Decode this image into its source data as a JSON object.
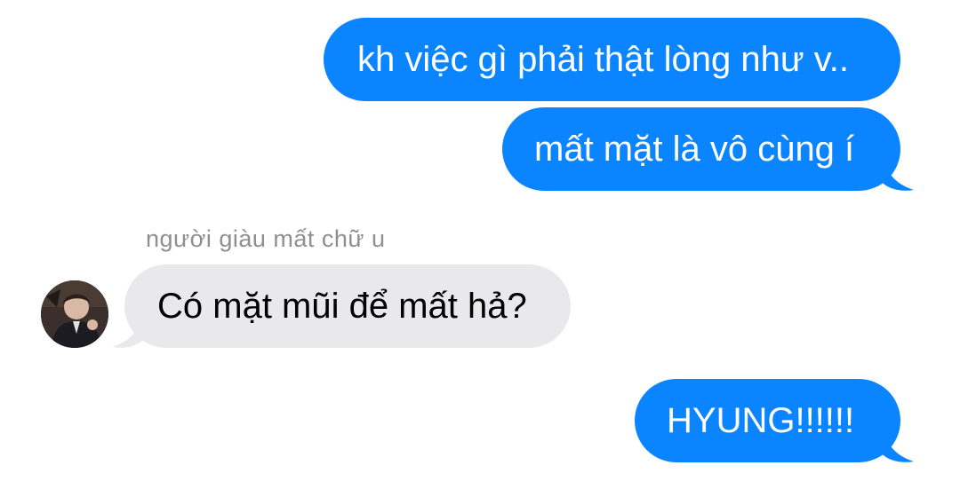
{
  "conversation": {
    "messages": [
      {
        "direction": "outgoing",
        "text": "kh việc gì phải thật lòng như v.."
      },
      {
        "direction": "outgoing",
        "text": "mất mặt là vô cùng í"
      },
      {
        "direction": "incoming",
        "sender": "người giàu mất chữ u",
        "text": "Có mặt mũi để mất hả?"
      },
      {
        "direction": "outgoing",
        "text": "HYUNG!!!!!!"
      }
    ]
  },
  "colors": {
    "outgoing_bubble": "#0a84ff",
    "incoming_bubble": "#e9e9eb",
    "sender_name": "#8e8e93"
  },
  "icons": {
    "avatar": "profile-photo"
  }
}
